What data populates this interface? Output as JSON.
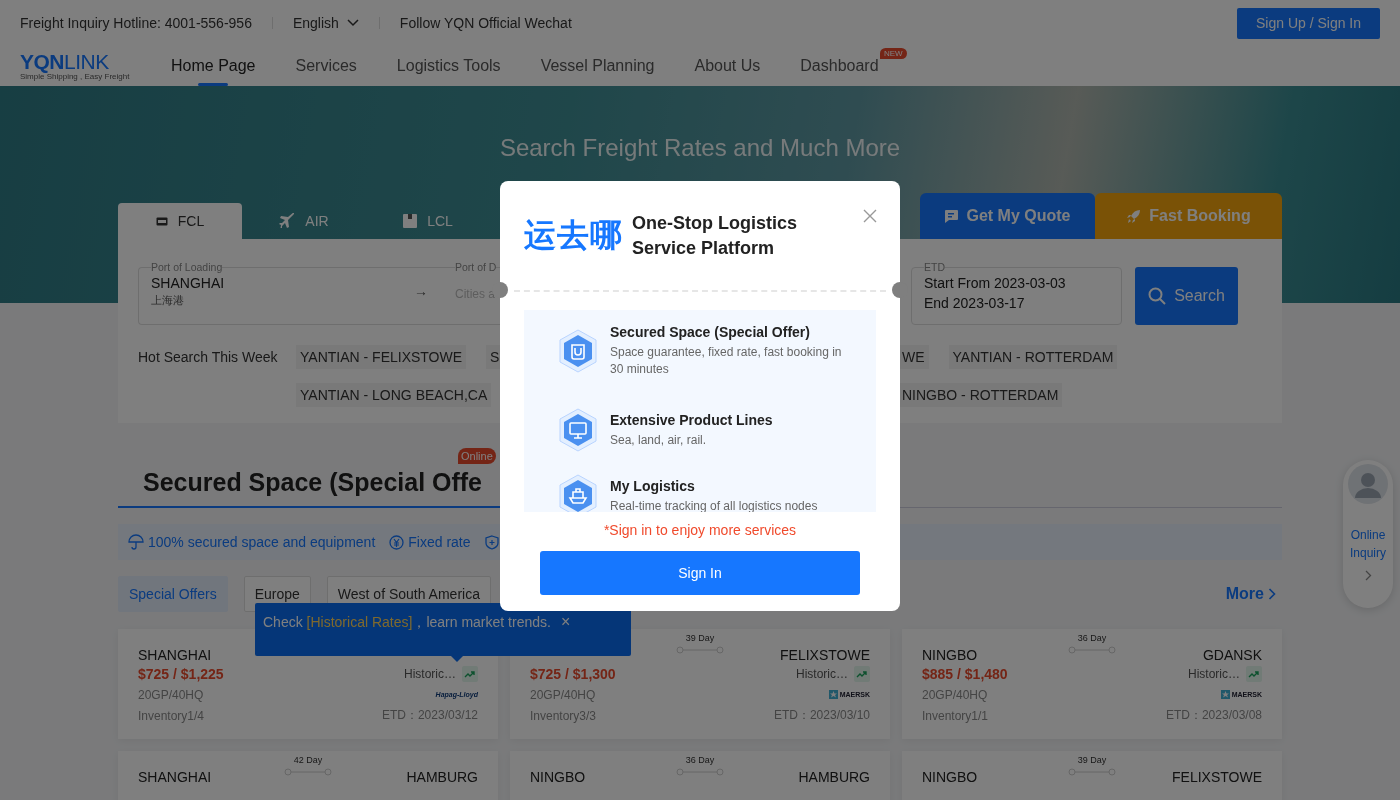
{
  "top_bar": {
    "hotline": "Freight Inquiry Hotline: 4001-556-956",
    "language": "English",
    "wechat": "Follow YQN Official Wechat",
    "sign_button": "Sign Up / Sign In"
  },
  "logo": {
    "name_a": "YQN",
    "name_b": "LINK",
    "tagline": "Simple Shipping , Easy Freight"
  },
  "nav": [
    {
      "label": "Home Page",
      "selected": true
    },
    {
      "label": "Services",
      "selected": false
    },
    {
      "label": "Logistics Tools",
      "selected": false
    },
    {
      "label": "Vessel Planning",
      "selected": false
    },
    {
      "label": "About Us",
      "selected": false
    },
    {
      "label": "Dashboard",
      "selected": false,
      "badge": "NEW"
    }
  ],
  "hero": {
    "title": "Search Freight Rates and Much More"
  },
  "search_panel": {
    "tabs": [
      {
        "label": "FCL",
        "kind": "container",
        "selected": true
      },
      {
        "label": "AIR",
        "kind": "plane",
        "selected": false
      },
      {
        "label": "LCL",
        "kind": "box",
        "selected": false
      }
    ],
    "actions": [
      {
        "label": "Get My Quote",
        "kind": "quote"
      },
      {
        "label": "Fast Booking",
        "kind": "booking"
      }
    ],
    "port_of_loading": {
      "label": "Port of Loading",
      "value": "SHANGHAI",
      "sublabel": "上海港"
    },
    "arrow": "→",
    "port_of_discharge": {
      "label": "Port of D",
      "placeholder": "Cities a"
    },
    "etd": {
      "label": "ETD",
      "start": "Start From 2023-03-03",
      "end": "End 2023-03-17"
    },
    "search_button": "Search",
    "hot_search": {
      "label": "Hot Search This Week",
      "rows": [
        {
          "left": [
            "YANTIAN - FELIXSTOWE",
            "S"
          ],
          "right": [
            "WE",
            "YANTIAN - ROTTERDAM"
          ]
        },
        {
          "left": [
            "YANTIAN - LONG BEACH,CA"
          ],
          "right": [
            "NINGBO - ROTTERDAM"
          ]
        }
      ]
    }
  },
  "section": {
    "title": "Secured Space (Special Offe",
    "badge": "Online",
    "features": [
      {
        "kind": "umbrella",
        "label": "100% secured space and equipment"
      },
      {
        "kind": "yuan",
        "label": "Fixed rate"
      },
      {
        "kind": "shield"
      }
    ],
    "filters": [
      {
        "label": "Special Offers",
        "selected": true
      },
      {
        "label": "Europe",
        "selected": false
      },
      {
        "label": "West of South America",
        "selected": false
      }
    ],
    "more": "More"
  },
  "cards": [
    {
      "origin": "SHANGHAI",
      "price": "$725 / $1,225",
      "historic": "Historic…",
      "container": "20GP/40HQ",
      "carrier": "Hapag-Lloyd",
      "kind": "hapag",
      "inventory": "Inventory1/4",
      "etd": "ETD：2023/03/12"
    },
    {
      "days": "39 Day",
      "destination": "FELIXSTOWE",
      "price": "$725 / $1,300",
      "historic": "Historic…",
      "container": "20GP/40HQ",
      "carrier": "MAERSK",
      "kind": "maersk",
      "inventory": "Inventory3/3",
      "etd": "ETD：2023/03/10"
    },
    {
      "origin": "NINGBO",
      "days": "36 Day",
      "destination": "GDANSK",
      "price": "$885 / $1,480",
      "historic": "Historic…",
      "container": "20GP/40HQ",
      "carrier": "MAERSK",
      "kind": "maersk",
      "inventory": "Inventory1/1",
      "etd": "ETD：2023/03/08"
    },
    {
      "origin": "SHANGHAI",
      "days": "42 Day",
      "destination": "HAMBURG"
    },
    {
      "origin": "NINGBO",
      "days": "36 Day",
      "destination": "HAMBURG"
    },
    {
      "origin": "NINGBO",
      "days": "39 Day",
      "destination": "FELIXSTOWE"
    }
  ],
  "tooltip": {
    "prefix": "Check ",
    "link": "[Historical Rates]",
    "suffix": "，learn market trends.",
    "close": "×"
  },
  "inquiry": {
    "label": "Online Inquiry"
  },
  "modal": {
    "brand": "运去哪",
    "title": "One-Stop Logistics Service Platform",
    "features": [
      {
        "kind": "bag",
        "title": "Secured Space (Special Offer)",
        "description": "Space guarantee, fixed rate, fast booking in 30 minutes"
      },
      {
        "kind": "monitor",
        "title": "Extensive Product Lines",
        "description": "Sea, land, air, rail."
      },
      {
        "kind": "ship",
        "title": "My Logistics",
        "description": "Real-time tracking of all logistics nodes"
      }
    ],
    "notice": "*Sign in to enjoy more services",
    "sign_in": "Sign In"
  }
}
